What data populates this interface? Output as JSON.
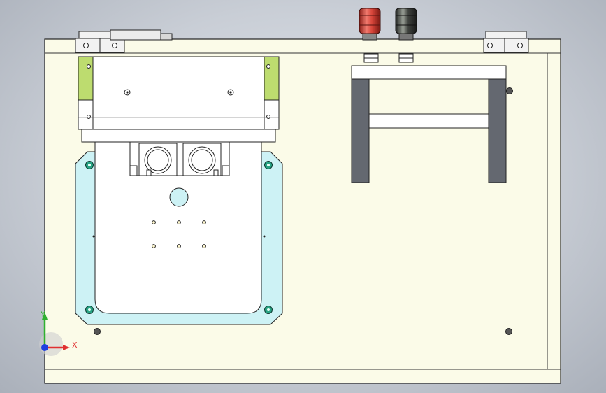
{
  "viewport": {
    "type": "cad-3d-viewport",
    "view": "front",
    "colors": {
      "background_center": "#e4e8ee",
      "background_edge": "#aab0ba",
      "panel_fill": "#fbfbe8",
      "inner_plate_fill": "#cdf2f5",
      "hinge_fill": "#f2f2f2",
      "green_pad": "#bddc6f",
      "dark_post": "#646870",
      "red_terminal": "#d8463b",
      "black_terminal": "#3e413d",
      "teal_screw": "#27a383"
    }
  },
  "triad": {
    "x_label": "X",
    "y_label": "Y",
    "x_color": "#e03030",
    "y_color": "#30b030",
    "z_color": "#2040e0"
  }
}
